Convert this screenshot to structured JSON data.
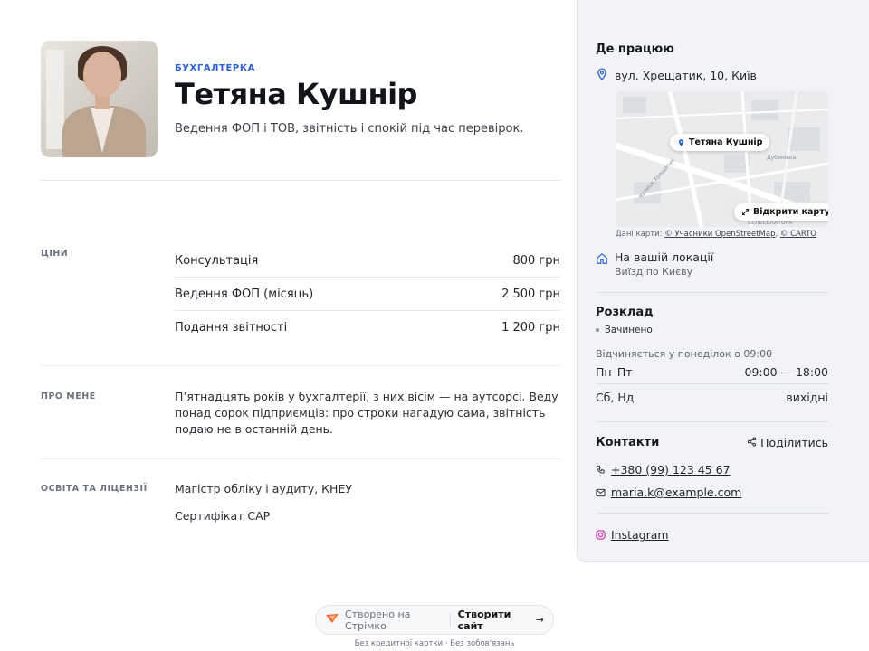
{
  "profile": {
    "eyebrow": "БУХГАЛТЕРКА",
    "name": "Тетяна Кушнір",
    "tagline": "Ведення ФОП і ТОВ, звітність і спокій під час перевірок."
  },
  "prices": {
    "label": "ЦІНИ",
    "items": [
      {
        "name": "Консультація",
        "price": "800 грн"
      },
      {
        "name": "Ведення ФОП (місяць)",
        "price": "2 500 грн"
      },
      {
        "name": "Подання звітності",
        "price": "1 200 грн"
      }
    ]
  },
  "about": {
    "label": "ПРО МЕНЕ",
    "text": "П’ятнадцять років у бухгалтерії, з них вісім — на аутсорсі. Веду понад сорок підприємців: про строки нагадую сама, звітність подаю не в останній день."
  },
  "education": {
    "label": "ОСВІТА ТА ЛІЦЕНЗІЇ",
    "items": [
      "Магістр обліку і аудиту, КНЕУ",
      "Сертифікат CAP"
    ]
  },
  "location": {
    "title": "Де працюю",
    "address": "вул. Хрещатик, 10, Київ",
    "map_pin_label": "Тетяна Кушнір",
    "open_map": "Відкрити карту",
    "credit_prefix": "Дані карти:",
    "credit_osm": "© Учасники OpenStreetMap",
    "credit_sep": ",",
    "credit_carto": "© CARTO",
    "onsite_title": "На вашій локації",
    "onsite_sub": "Виїзд по Києву",
    "map_labels": {
      "street": "вулиця Хрещатик",
      "district": "Дубинівка",
      "bottom": "БЕЛЬСЬКАТОРА"
    }
  },
  "schedule": {
    "title": "Розклад",
    "status": "Зачинено",
    "next_open": "Відчиняється у понеділок о 09:00",
    "rows": [
      {
        "days": "Пн–Пт",
        "hours": "09:00 — 18:00"
      },
      {
        "days": "Сб, Нд",
        "hours": "вихідні"
      }
    ]
  },
  "contacts": {
    "title": "Контакти",
    "share": "Поділитись",
    "phone": "+380 (99) 123 45 67",
    "email": "maria.k@example.com",
    "instagram": "Instagram"
  },
  "footer": {
    "made_with": "Створено на Стрімко",
    "create": "Створити сайт",
    "note": "Без кредитної картки · Без зобов'язань"
  },
  "colors": {
    "accent": "#2b5fd9",
    "sidebar_bg": "#f1f3f7",
    "brand_orange": "#f06a2b"
  }
}
